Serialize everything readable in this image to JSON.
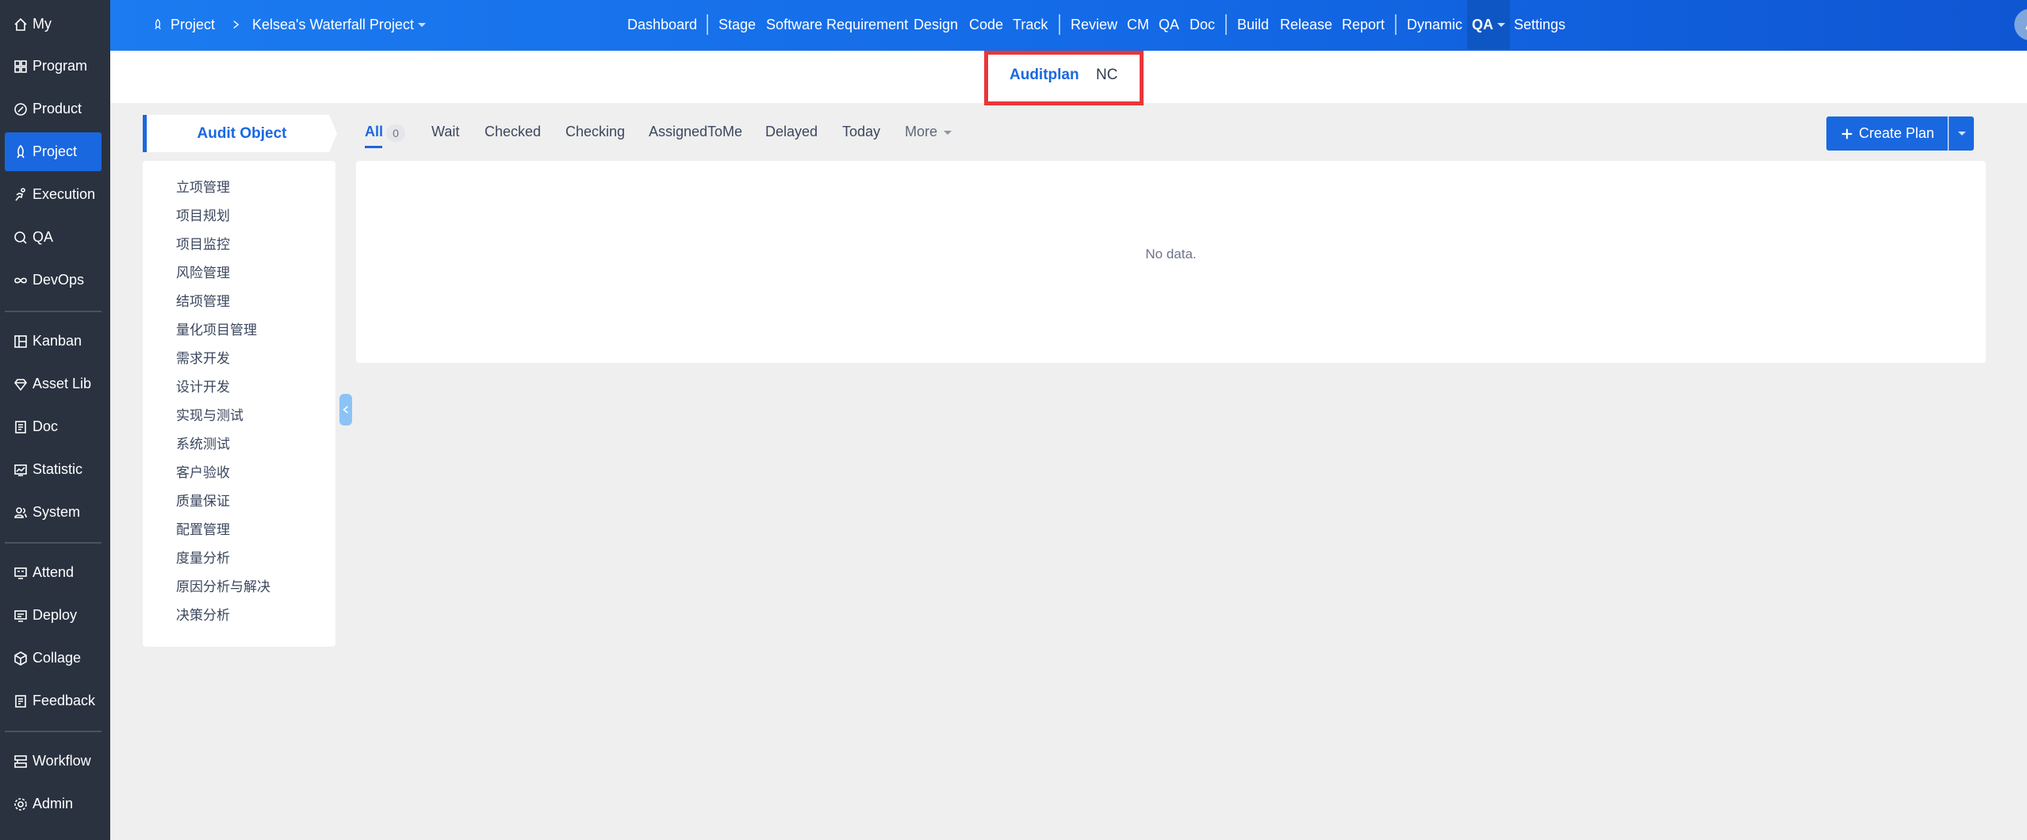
{
  "sidebar": {
    "items": [
      {
        "label": "My",
        "icon": "home-icon"
      },
      {
        "label": "Program",
        "icon": "grid-icon"
      },
      {
        "label": "Product",
        "icon": "product-icon"
      },
      {
        "label": "Project",
        "icon": "rocket-icon",
        "active": true
      },
      {
        "label": "Execution",
        "icon": "run-icon"
      },
      {
        "label": "QA",
        "icon": "qa-search-icon"
      },
      {
        "label": "DevOps",
        "icon": "infinity-icon"
      },
      {
        "label": "Kanban",
        "icon": "kanban-icon"
      },
      {
        "label": "Asset Lib",
        "icon": "diamond-icon"
      },
      {
        "label": "Doc",
        "icon": "doc-icon"
      },
      {
        "label": "Statistic",
        "icon": "statistic-icon"
      },
      {
        "label": "System",
        "icon": "users-icon"
      },
      {
        "label": "Attend",
        "icon": "attend-icon"
      },
      {
        "label": "Deploy",
        "icon": "deploy-icon"
      },
      {
        "label": "Collage",
        "icon": "cube-icon"
      },
      {
        "label": "Feedback",
        "icon": "feedback-icon"
      },
      {
        "label": "Workflow",
        "icon": "workflow-icon"
      },
      {
        "label": "Admin",
        "icon": "gear-icon"
      }
    ]
  },
  "topbar": {
    "project_label": "Project",
    "project_name": "Kelsea's Waterfall Project",
    "nav": [
      "Dashboard",
      "Stage",
      "Software Requirement",
      "Design",
      "Code",
      "Track",
      "Review",
      "CM",
      "QA",
      "Doc",
      "Build",
      "Release",
      "Report",
      "Dynamic",
      "QA",
      "Settings"
    ],
    "avatar_letter": "A"
  },
  "subnav": {
    "tabs": [
      "Auditplan",
      "NC"
    ],
    "active": "Auditplan",
    "highlight_color": "#e8373a"
  },
  "audit_panel": {
    "title": "Audit Object",
    "items": [
      "立项管理",
      "项目规划",
      "项目监控",
      "风险管理",
      "结项管理",
      "量化项目管理",
      "需求开发",
      "设计开发",
      "实现与测试",
      "系统测试",
      "客户验收",
      "质量保证",
      "配置管理",
      "度量分析",
      "原因分析与解决",
      "决策分析"
    ]
  },
  "filters": {
    "tabs": [
      "All",
      "Wait",
      "Checked",
      "Checking",
      "AssignedToMe",
      "Delayed",
      "Today",
      "More"
    ],
    "all_count": "0"
  },
  "actions": {
    "create_plan": "Create Plan"
  },
  "table": {
    "empty_text": "No data."
  },
  "colors": {
    "primary": "#1a68e0",
    "sidebar_bg": "#2a3240",
    "page_bg": "#efefef"
  }
}
